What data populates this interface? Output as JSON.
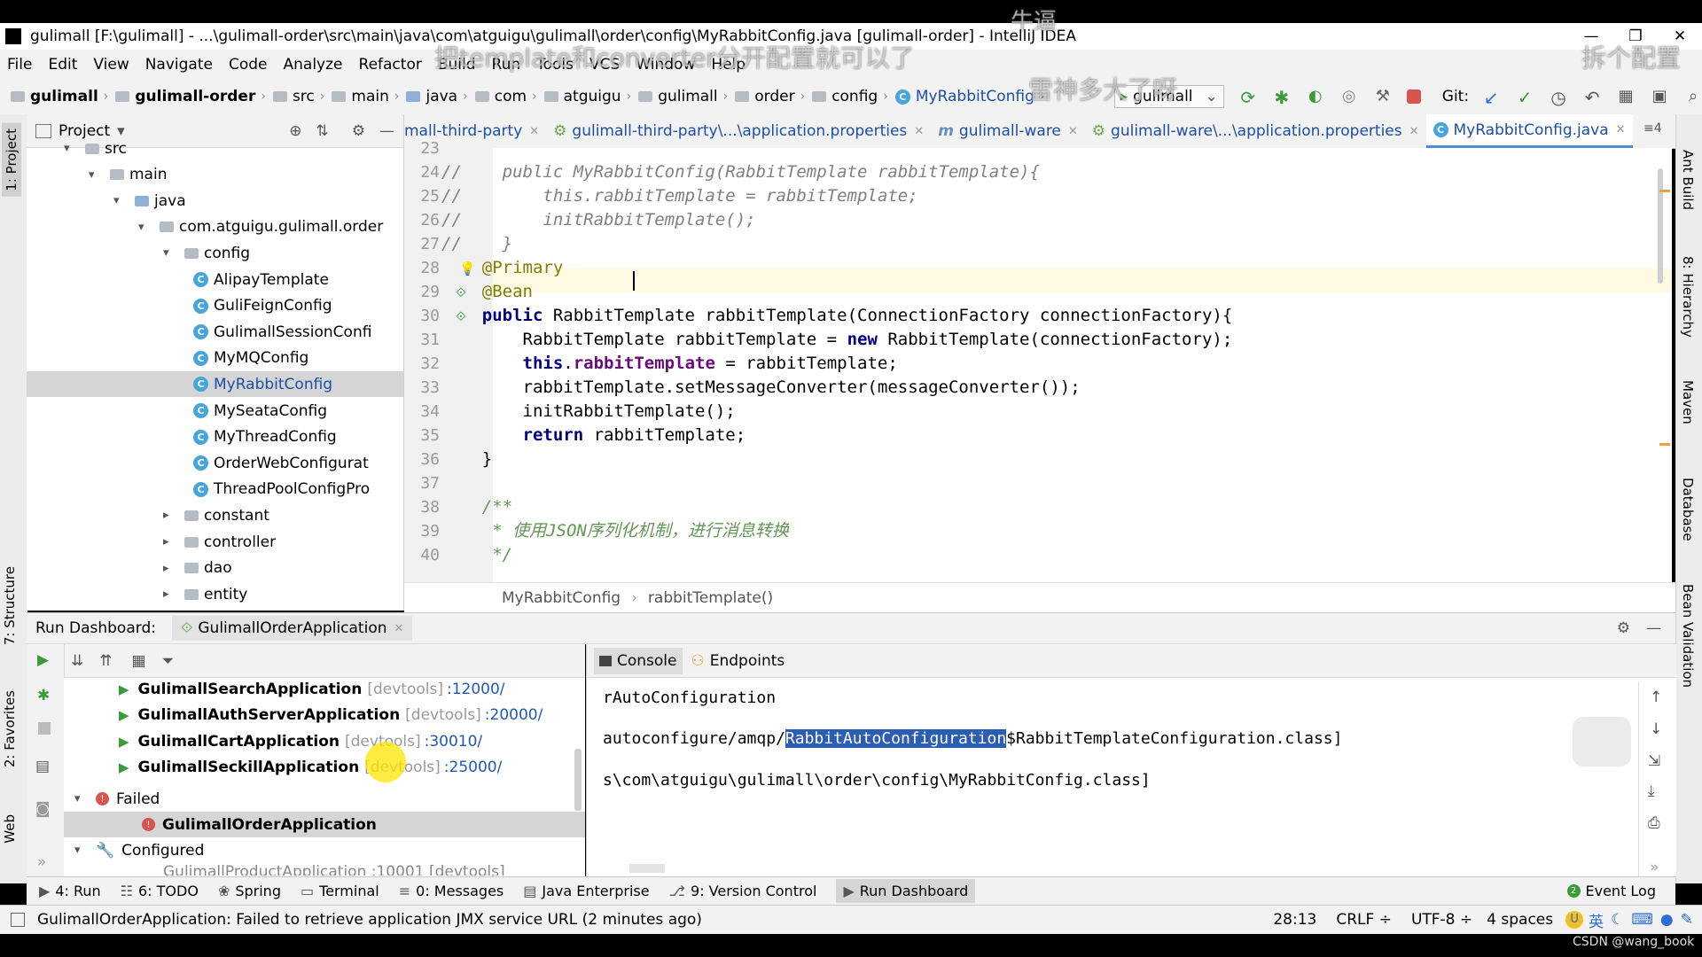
{
  "window": {
    "title": "gulimall [F:\\gulimall] - ...\\gulimall-order\\src\\main\\java\\com\\atguigu\\gulimall\\order\\config\\MyRabbitConfig.java [gulimall-order] - IntelliJ IDEA"
  },
  "menu": [
    "File",
    "Edit",
    "View",
    "Navigate",
    "Code",
    "Analyze",
    "Refactor",
    "Build",
    "Run",
    "Tools",
    "VCS",
    "Window",
    "Help"
  ],
  "breadcrumbs": [
    "gulimall",
    "gulimall-order",
    "src",
    "main",
    "java",
    "com",
    "atguigu",
    "gulimall",
    "order",
    "config",
    "MyRabbitConfig"
  ],
  "run_config": "gulimall",
  "git_label": "Git:",
  "project_panel": {
    "title": "Project",
    "tree": [
      {
        "label": "src",
        "indent": 0,
        "type": "folder",
        "arrow": "▾"
      },
      {
        "label": "main",
        "indent": 1,
        "type": "folder",
        "arrow": "▾"
      },
      {
        "label": "java",
        "indent": 2,
        "type": "folder",
        "arrow": "▾"
      },
      {
        "label": "com.atguigu.gulimall.order",
        "indent": 3,
        "type": "folder",
        "arrow": "▾"
      },
      {
        "label": "config",
        "indent": 4,
        "type": "folder",
        "arrow": "▾"
      },
      {
        "label": "AlipayTemplate",
        "indent": 5,
        "type": "class"
      },
      {
        "label": "GuliFeignConfig",
        "indent": 5,
        "type": "class"
      },
      {
        "label": "GulimallSessionConfi",
        "indent": 5,
        "type": "class"
      },
      {
        "label": "MyMQConfig",
        "indent": 5,
        "type": "class"
      },
      {
        "label": "MyRabbitConfig",
        "indent": 5,
        "type": "class",
        "selected": true
      },
      {
        "label": "MySeataConfig",
        "indent": 5,
        "type": "class"
      },
      {
        "label": "MyThreadConfig",
        "indent": 5,
        "type": "class"
      },
      {
        "label": "OrderWebConfigurat",
        "indent": 5,
        "type": "class"
      },
      {
        "label": "ThreadPoolConfigPro",
        "indent": 5,
        "type": "class"
      },
      {
        "label": "constant",
        "indent": 4,
        "type": "folder",
        "arrow": "▸"
      },
      {
        "label": "controller",
        "indent": 4,
        "type": "folder",
        "arrow": "▸"
      },
      {
        "label": "dao",
        "indent": 4,
        "type": "folder",
        "arrow": "▸"
      },
      {
        "label": "entity",
        "indent": 4,
        "type": "folder",
        "arrow": "▸"
      }
    ]
  },
  "editor_tabs": [
    {
      "label": "mall-third-party",
      "icon": "module"
    },
    {
      "label": "gulimall-third-party\\...\\application.properties",
      "icon": "props"
    },
    {
      "label": "gulimall-ware",
      "icon": "module"
    },
    {
      "label": "gulimall-ware\\...\\application.properties",
      "icon": "props"
    },
    {
      "label": "MyRabbitConfig.java",
      "icon": "class",
      "active": true
    }
  ],
  "code": {
    "line_numbers": [
      "23",
      "24",
      "25",
      "26",
      "27",
      "28",
      "29",
      "30",
      "31",
      "32",
      "33",
      "34",
      "35",
      "36",
      "37",
      "38",
      "39",
      "40"
    ],
    "lines": [
      "",
      "//    public MyRabbitConfig(RabbitTemplate rabbitTemplate){",
      "//        this.rabbitTemplate = rabbitTemplate;",
      "//        initRabbitTemplate();",
      "//    }",
      "    @Primary",
      "    @Bean",
      "    public RabbitTemplate rabbitTemplate(ConnectionFactory connectionFactory){",
      "        RabbitTemplate rabbitTemplate = new RabbitTemplate(connectionFactory);",
      "        this.rabbitTemplate = rabbitTemplate;",
      "        rabbitTemplate.setMessageConverter(messageConverter());",
      "        initRabbitTemplate();",
      "        return rabbitTemplate;",
      "    }",
      "",
      "    /**",
      "     * 使用JSON序列化机制，进行消息转换",
      "     */"
    ]
  },
  "editor_breadcrumb": [
    "MyRabbitConfig",
    "rabbitTemplate()"
  ],
  "run_dashboard": {
    "title": "Run Dashboard:",
    "tab": "GulimallOrderApplication",
    "apps": [
      {
        "name": "GulimallSearchApplication",
        "tag": "[devtools]",
        "port": ":12000/"
      },
      {
        "name": "GulimallAuthServerApplication",
        "tag": "[devtools]",
        "port": ":20000/"
      },
      {
        "name": "GulimallCartApplication",
        "tag": "[devtools]",
        "port": ":30010/"
      },
      {
        "name": "GulimallSeckillApplication",
        "tag": "[devtools]",
        "port": ":25000/"
      }
    ],
    "failed_group": "Failed",
    "failed_app": "GulimallOrderApplication",
    "configured_group": "Configured",
    "configured_partial": "GulimallProductApplication :10001 [devtools]"
  },
  "console": {
    "tabs": [
      "Console",
      "Endpoints"
    ],
    "line1": "rAutoConfiguration",
    "line2_pre": "autoconfigure/amqp/",
    "line2_hl": "RabbitAutoConfiguration",
    "line2_post": "$RabbitTemplateConfiguration.class]",
    "line3": "s\\com\\atguigu\\gulimall\\order\\config\\MyRabbitConfig.class]"
  },
  "tool_windows": [
    {
      "label": "4: Run"
    },
    {
      "label": "6: TODO"
    },
    {
      "label": "Spring"
    },
    {
      "label": "Terminal"
    },
    {
      "label": "0: Messages"
    },
    {
      "label": "Java Enterprise"
    },
    {
      "label": "9: Version Control"
    },
    {
      "label": "Run Dashboard",
      "active": true
    }
  ],
  "event_log": "Event Log",
  "status": {
    "message": "GulimallOrderApplication: Failed to retrieve application JMX service URL (2 minutes ago)",
    "position": "28:13",
    "line_sep": "CRLF",
    "encoding": "UTF-8",
    "indent": "4 spaces",
    "ime": "英"
  },
  "left_tool_tabs": [
    "1: Project",
    "7: Structure",
    "2: Favorites",
    "Web"
  ],
  "right_tool_tabs": [
    "Ant Build",
    "8: Hierarchy",
    "Maven",
    "Database",
    "Bean Validation"
  ],
  "overlay": {
    "top_center": "牛逼",
    "banner": "把template和converter分开配置就可以了",
    "right": "拆个配置",
    "mid": "雷神多大了呀",
    "credit": "CSDN @wang_book"
  },
  "colors": {
    "accent": "#4d8be0",
    "selection": "#2b5db5",
    "run_green": "#3a9b3a",
    "fail_red": "#d9534f"
  }
}
